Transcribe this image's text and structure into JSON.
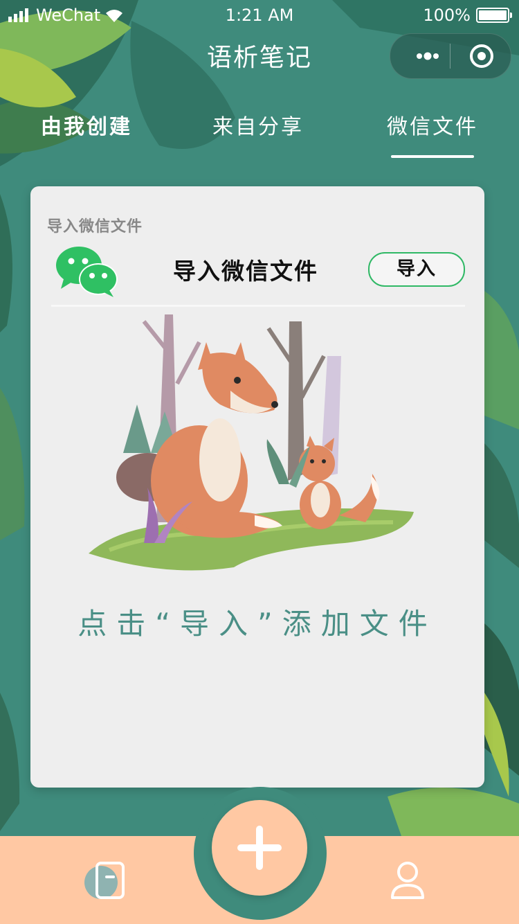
{
  "status_bar": {
    "carrier": "WeChat",
    "time": "1:21 AM",
    "battery": "100%"
  },
  "nav": {
    "title": "语析笔记"
  },
  "tabs": [
    {
      "label": "由我创建"
    },
    {
      "label": "来自分享"
    },
    {
      "label": "微信文件"
    }
  ],
  "active_tab": 2,
  "card": {
    "caption": "导入微信文件",
    "import_title": "导入微信文件",
    "import_button": "导入",
    "hint": "点击“导入”添加文件"
  },
  "colors": {
    "background": "#3f8b7c",
    "card": "#eeeeee",
    "accent_green": "#2fb865",
    "bottom_bar": "#ffc8a3",
    "hint_text": "#4a8f86"
  },
  "icons": {
    "signal": "signal-icon",
    "wifi": "wifi-icon",
    "battery": "battery-icon",
    "more": "more-icon",
    "close": "close-target-icon",
    "wechat": "wechat-icon",
    "add": "plus-icon",
    "notes": "notes-icon",
    "profile": "profile-icon"
  }
}
